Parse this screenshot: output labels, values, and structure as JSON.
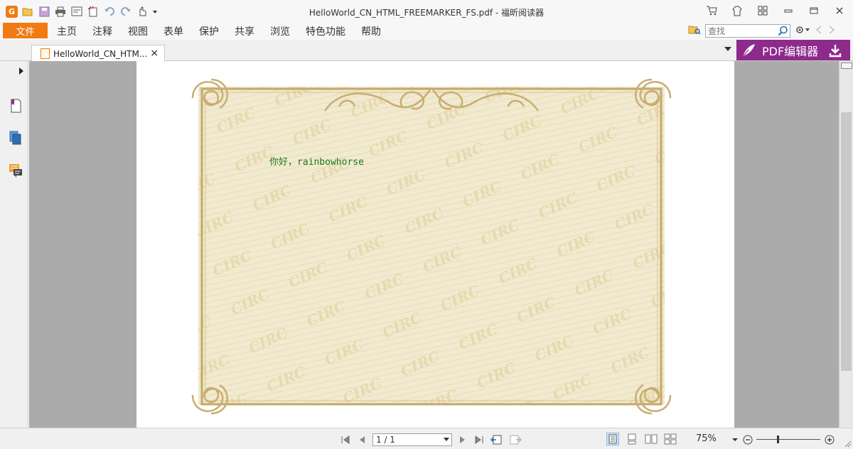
{
  "window": {
    "title": "HelloWorld_CN_HTML_FREEMARKER_FS.pdf - 福昕阅读器"
  },
  "quick_access": {
    "icons": [
      "app-logo",
      "open-folder-icon",
      "save-icon",
      "print-icon",
      "properties-icon",
      "new-icon",
      "undo-icon",
      "redo-icon",
      "hand-tool-icon",
      "customize-dropdown-icon"
    ],
    "logo_letter": "G"
  },
  "window_controls": {
    "icons": [
      "cart-icon",
      "skin-icon",
      "apps-icon",
      "minimize-icon",
      "restore-icon",
      "close-icon"
    ]
  },
  "menubar": {
    "file_label": "文件",
    "items": [
      "主页",
      "注释",
      "视图",
      "表单",
      "保护",
      "共享",
      "浏览",
      "特色功能",
      "帮助"
    ]
  },
  "search": {
    "placeholder": "查找"
  },
  "tab": {
    "label": "HelloWorld_CN_HTM...",
    "close": "×"
  },
  "promo": {
    "label": "PDF编辑器"
  },
  "document": {
    "greeting": "你好，rainbowhorse",
    "watermark": "CIRC"
  },
  "status": {
    "page_field": "1 / 1",
    "zoom": "75%"
  },
  "colors": {
    "accent": "#f07b13",
    "promo": "#8e2a8c",
    "greeting": "#1a7a1a"
  }
}
